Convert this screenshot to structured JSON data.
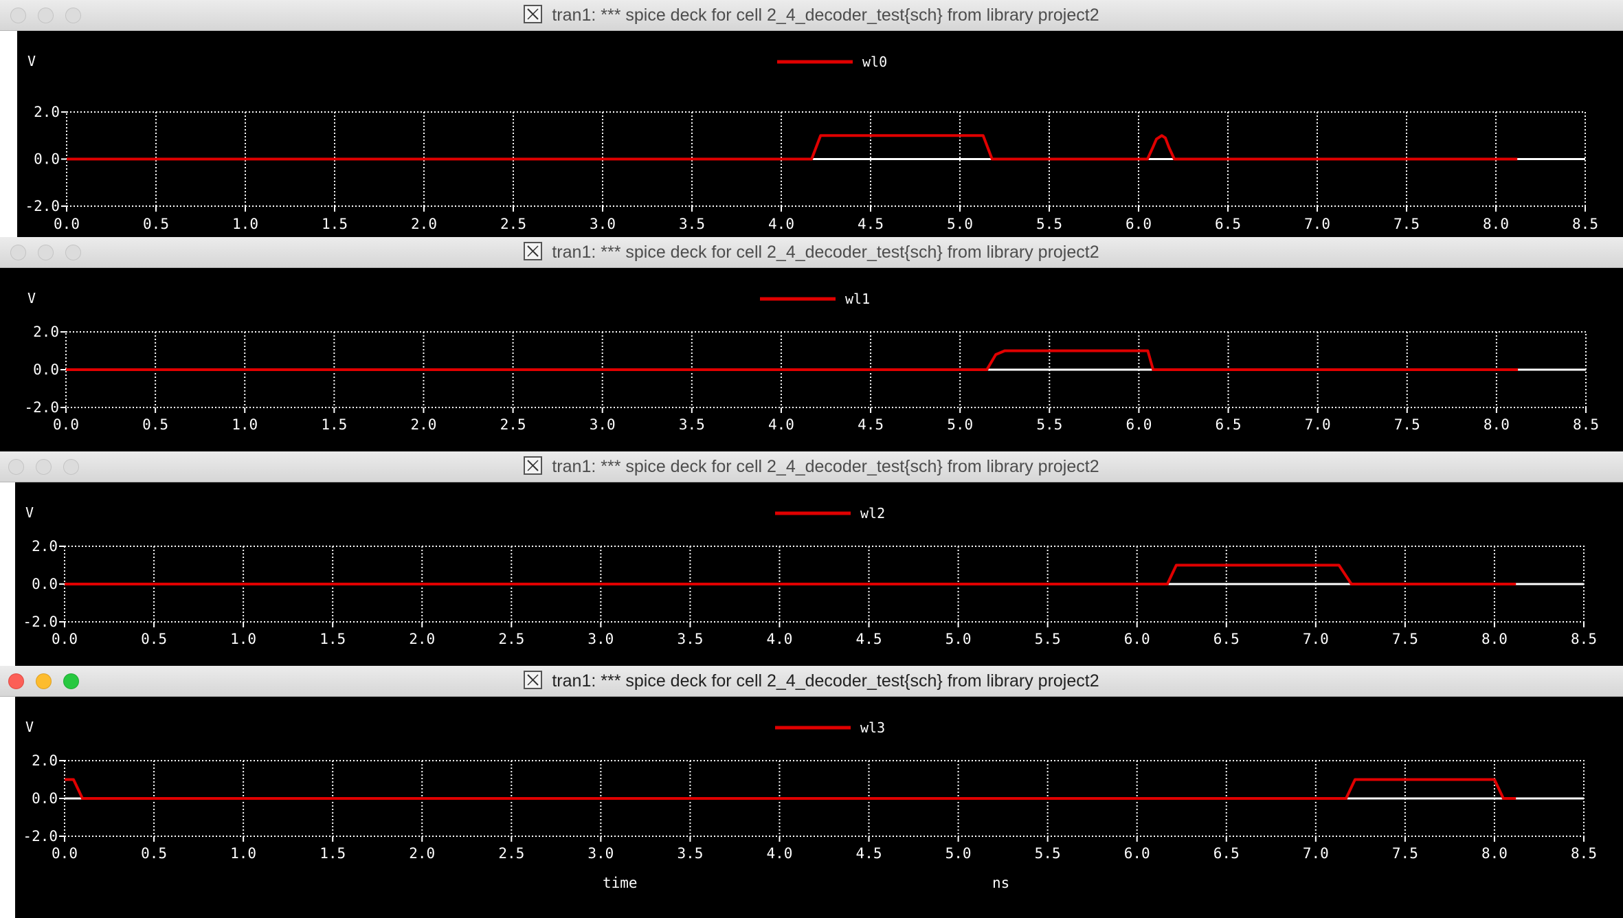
{
  "windows": [
    {
      "title": "tran1: *** spice deck for cell 2_4_decoder_test{sch} from library project2",
      "active": false,
      "signal": "wl0",
      "unit": "V",
      "y_ticks": [
        "2.0",
        "0.0",
        "-2.0"
      ],
      "x_ticks": [
        "0.0",
        "0.5",
        "1.0",
        "1.5",
        "2.0",
        "2.5",
        "3.0",
        "3.5",
        "4.0",
        "4.5",
        "5.0",
        "5.5",
        "6.0",
        "6.5",
        "7.0",
        "7.5",
        "8.0",
        "8.5"
      ],
      "x_axis_label": "",
      "x_axis_unit": ""
    },
    {
      "title": "tran1: *** spice deck for cell 2_4_decoder_test{sch} from library project2",
      "active": false,
      "signal": "wl1",
      "unit": "V",
      "y_ticks": [
        "2.0",
        "0.0",
        "-2.0"
      ],
      "x_ticks": [
        "0.0",
        "0.5",
        "1.0",
        "1.5",
        "2.0",
        "2.5",
        "3.0",
        "3.5",
        "4.0",
        "4.5",
        "5.0",
        "5.5",
        "6.0",
        "6.5",
        "7.0",
        "7.5",
        "8.0",
        "8.5"
      ],
      "x_axis_label": "",
      "x_axis_unit": ""
    },
    {
      "title": "tran1: *** spice deck for cell 2_4_decoder_test{sch} from library project2",
      "active": false,
      "signal": "wl2",
      "unit": "V",
      "y_ticks": [
        "2.0",
        "0.0",
        "-2.0"
      ],
      "x_ticks": [
        "0.0",
        "0.5",
        "1.0",
        "1.5",
        "2.0",
        "2.5",
        "3.0",
        "3.5",
        "4.0",
        "4.5",
        "5.0",
        "5.5",
        "6.0",
        "6.5",
        "7.0",
        "7.5",
        "8.0",
        "8.5"
      ],
      "x_axis_label": "",
      "x_axis_unit": ""
    },
    {
      "title": "tran1: *** spice deck for cell 2_4_decoder_test{sch} from library project2",
      "active": true,
      "signal": "wl3",
      "unit": "V",
      "y_ticks": [
        "2.0",
        "0.0",
        "-2.0"
      ],
      "x_ticks": [
        "0.0",
        "0.5",
        "1.0",
        "1.5",
        "2.0",
        "2.5",
        "3.0",
        "3.5",
        "4.0",
        "4.5",
        "5.0",
        "5.5",
        "6.0",
        "6.5",
        "7.0",
        "7.5",
        "8.0",
        "8.5"
      ],
      "x_axis_label": "time",
      "x_axis_unit": "ns"
    }
  ],
  "colors": {
    "trace": "#e00000",
    "grid": "#ffffff",
    "baseline": "#ffffff",
    "background": "#000000"
  },
  "chart_data": [
    {
      "type": "line",
      "series": [
        {
          "name": "wl0",
          "x": [
            0.0,
            4.17,
            4.22,
            5.13,
            5.18,
            6.05,
            6.08,
            6.1,
            6.13,
            6.15,
            6.17,
            6.2,
            8.12
          ],
          "y": [
            0.0,
            0.0,
            1.0,
            1.0,
            0.0,
            0.0,
            0.5,
            0.85,
            1.0,
            0.9,
            0.5,
            0.0,
            0.0
          ]
        }
      ],
      "xlim": [
        0,
        8.5
      ],
      "ylim": [
        -2,
        2
      ],
      "grid": true,
      "legend": "top-center"
    },
    {
      "type": "line",
      "series": [
        {
          "name": "wl1",
          "x": [
            0.0,
            5.15,
            5.2,
            5.25,
            6.05,
            6.08,
            8.12
          ],
          "y": [
            0.0,
            0.0,
            0.8,
            1.0,
            1.0,
            0.0,
            0.0
          ]
        }
      ],
      "xlim": [
        0,
        8.5
      ],
      "ylim": [
        -2,
        2
      ],
      "grid": true,
      "legend": "top-center"
    },
    {
      "type": "line",
      "series": [
        {
          "name": "wl2",
          "x": [
            0.0,
            6.17,
            6.22,
            7.13,
            7.2,
            8.12
          ],
          "y": [
            0.0,
            0.0,
            1.0,
            1.0,
            0.0,
            0.0
          ]
        }
      ],
      "xlim": [
        0,
        8.5
      ],
      "ylim": [
        -2,
        2
      ],
      "grid": true,
      "legend": "top-center"
    },
    {
      "type": "line",
      "series": [
        {
          "name": "wl3",
          "x": [
            0.0,
            0.05,
            0.1,
            7.17,
            7.22,
            8.0,
            8.05,
            8.12
          ],
          "y": [
            1.0,
            1.0,
            0.0,
            0.0,
            1.0,
            1.0,
            0.0,
            0.0
          ]
        }
      ],
      "xlim": [
        0,
        8.5
      ],
      "ylim": [
        -2,
        2
      ],
      "grid": true,
      "legend": "top-center",
      "xlabel": "time",
      "xunit": "ns"
    }
  ]
}
